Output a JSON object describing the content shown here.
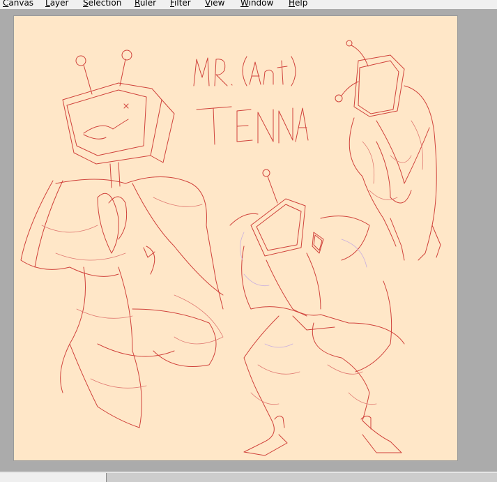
{
  "menubar": {
    "items": [
      {
        "label": "Canvas",
        "mnemonic": "C",
        "rest": "anvas"
      },
      {
        "label": "Layer",
        "mnemonic": "L",
        "rest": "ayer"
      },
      {
        "label": "Selection",
        "mnemonic": "S",
        "rest": "election"
      },
      {
        "label": "Ruler",
        "mnemonic": "R",
        "rest": "uler"
      },
      {
        "label": "Filter",
        "mnemonic": "F",
        "rest": "ilter"
      },
      {
        "label": "View",
        "mnemonic": "V",
        "rest": "iew"
      },
      {
        "label": "Window",
        "mnemonic": "W",
        "rest": "indow"
      },
      {
        "label": "Help",
        "mnemonic": "H",
        "rest": "elp"
      }
    ]
  },
  "canvas": {
    "title_line1": "MR. (Ant)",
    "title_line2": "TENNA",
    "background_color": "#ffe7c8",
    "sketch_color": "#d0423b",
    "screen_fill_color": "#c8191b"
  },
  "colors": {
    "workspace": "#ababab",
    "menubar": "#f0f0f0"
  }
}
